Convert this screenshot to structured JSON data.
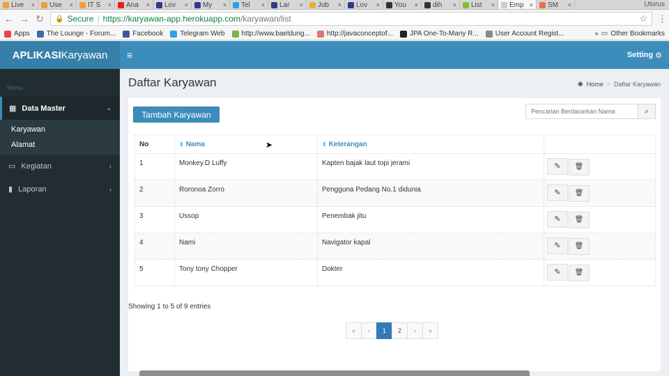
{
  "browser": {
    "tabs": [
      {
        "label": "Live",
        "color": "#f0a030"
      },
      {
        "label": "Use",
        "color": "#e8a040"
      },
      {
        "label": "IT S",
        "color": "#f0a030"
      },
      {
        "label": "Ana",
        "color": "#e62117"
      },
      {
        "label": "Lov",
        "color": "#2d3a8c"
      },
      {
        "label": "My",
        "color": "#2d3a8c"
      },
      {
        "label": "Tel",
        "color": "#2aa3e0"
      },
      {
        "label": "Lar",
        "color": "#2d3a8c"
      },
      {
        "label": "Job",
        "color": "#e8b040"
      },
      {
        "label": "Lov",
        "color": "#2d3a8c"
      },
      {
        "label": "You",
        "color": "#333333"
      },
      {
        "label": "dih",
        "color": "#333333"
      },
      {
        "label": "List",
        "color": "#7cc12f"
      },
      {
        "label": "Emp",
        "color": "#cccccc"
      },
      {
        "label": "SM",
        "color": "#e8704a"
      }
    ],
    "close_glyph": "×",
    "profile": "Utorus",
    "secure_label": "Secure",
    "url_separator": "|",
    "url_host": "https://karyawan-app.herokuapp.com",
    "url_path": "/karyawan/list",
    "bookmarks": [
      {
        "label": "Apps",
        "color": "#e44"
      },
      {
        "label": "The Lounge - Forum...",
        "color": "#3a6ea5"
      },
      {
        "label": "Facebook",
        "color": "#3b5998"
      },
      {
        "label": "Telegram Web",
        "color": "#2aa3e0"
      },
      {
        "label": "http://www.baeldung...",
        "color": "#7cb342"
      },
      {
        "label": "http://javaconceptof...",
        "color": "#e57373"
      },
      {
        "label": "JPA One-To-Many R...",
        "color": "#222222"
      },
      {
        "label": "User Account Regist...",
        "color": "#888888"
      }
    ],
    "overflow_glyph": "»",
    "other_bookmarks": "Other Bookmarks"
  },
  "header": {
    "logo_bold": "APLIKASI",
    "logo_light": "Karyawan",
    "setting_label": "Setting"
  },
  "sidebar": {
    "menu_header": "Menu",
    "data_master": "Data Master",
    "submenu": [
      "Karyawan",
      "Alamat"
    ],
    "kegiatan": "Kegiatan",
    "laporan": "Laporan"
  },
  "page": {
    "title": "Daftar Karyawan",
    "breadcrumb_home": "Home",
    "breadcrumb_sep": ">",
    "breadcrumb_current": "Daftar Karyawan",
    "add_button": "Tambah Karyawan",
    "search_placeholder": "Pencarian Berdasarkan Nama"
  },
  "table": {
    "headers": {
      "no": "No",
      "nama": "Nama",
      "keterangan": "Keterangan"
    },
    "rows": [
      {
        "no": "1",
        "nama": "Monkey.D Luffy",
        "keterangan": "Kapten bajak laut topi jerami"
      },
      {
        "no": "2",
        "nama": "Roronoa Zorro",
        "keterangan": "Pengguna Pedang No.1 didunia"
      },
      {
        "no": "3",
        "nama": "Ussop",
        "keterangan": "Penembak jitu"
      },
      {
        "no": "4",
        "nama": "Nami",
        "keterangan": "Navigator kapal"
      },
      {
        "no": "5",
        "nama": "Tony tony Chopper",
        "keterangan": "Dokter"
      }
    ]
  },
  "footer": {
    "entries_info": "Showing 1 to 5 of 9 entries",
    "pagination": [
      "«",
      "‹",
      "1",
      "2",
      "›",
      "»"
    ],
    "active_page": "1"
  }
}
